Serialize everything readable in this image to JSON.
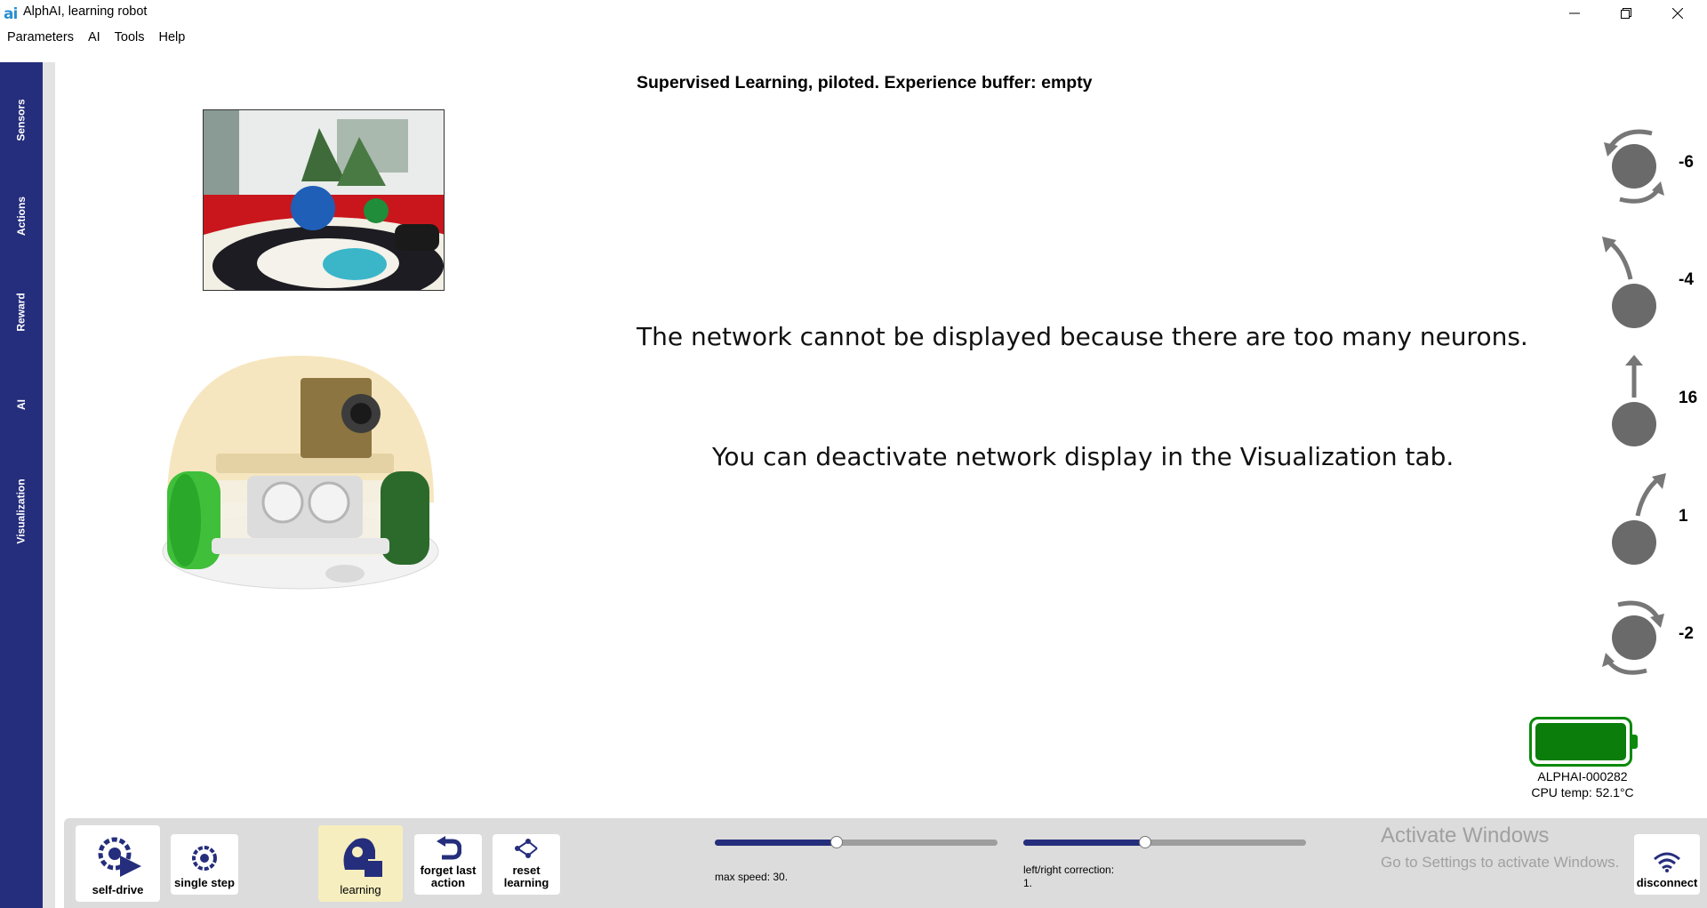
{
  "window": {
    "logo": "ai",
    "title": "AlphAI, learning robot"
  },
  "menu": [
    "Parameters",
    "AI",
    "Tools",
    "Help"
  ],
  "sidebar": {
    "tabs": [
      {
        "label": "Sensors"
      },
      {
        "label": "Actions"
      },
      {
        "label": "Reward"
      },
      {
        "label": "AI"
      },
      {
        "label": "Visualization"
      }
    ]
  },
  "main": {
    "status": "Supervised Learning, piloted. Experience buffer: empty",
    "message_line1": "The network cannot be displayed because there are too many neurons.",
    "message_line2": "You can deactivate network display in the Visualization tab."
  },
  "actions": [
    {
      "icon": "rotate-left-icon",
      "value": "-6"
    },
    {
      "icon": "turn-left-arrow-icon",
      "value": "-4"
    },
    {
      "icon": "forward-arrow-icon",
      "value": "16"
    },
    {
      "icon": "turn-right-arrow-icon",
      "value": "1"
    },
    {
      "icon": "rotate-right-icon",
      "value": "-2"
    }
  ],
  "status_panel": {
    "battery_level": 1.0,
    "battery_color": "#0a7d0a",
    "robot_id": "ALPHAI-000282",
    "cpu_temp": "CPU temp: 52.1°C"
  },
  "toolbar": {
    "self_drive": "self-drive",
    "single_step": "single step",
    "learning": "learning",
    "forget_last_action": "forget last action",
    "reset_learning": "reset learning",
    "disconnect": "disconnect"
  },
  "sliders": {
    "max_speed": {
      "label": "max speed: 30.",
      "fraction": 0.43
    },
    "correction": {
      "label": "left/right correction: 1.",
      "fraction": 0.43
    }
  },
  "watermark": {
    "line1": "Activate Windows",
    "line2": "Go to Settings to activate Windows."
  },
  "colors": {
    "accent": "#252e7c",
    "active_button": "#f6eebe"
  }
}
